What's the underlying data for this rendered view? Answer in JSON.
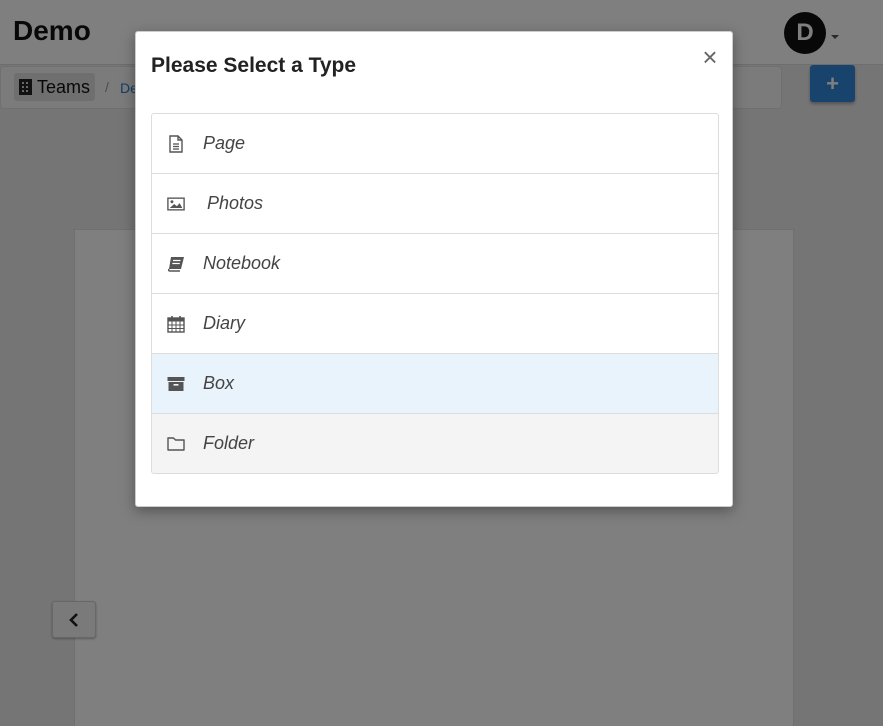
{
  "app": {
    "brand": "Demo",
    "avatar_initial": "D"
  },
  "breadcrumb": {
    "root_label": "Teams",
    "separator": "/",
    "next_label": "Demo"
  },
  "toolbar": {
    "add_symbol": "+"
  },
  "modal": {
    "title": "Please Select a Type",
    "close_symbol": "×",
    "options": [
      {
        "label": "Page",
        "icon": "file-text-icon"
      },
      {
        "label": "Photos",
        "icon": "image-icon"
      },
      {
        "label": "Notebook",
        "icon": "book-icon"
      },
      {
        "label": "Diary",
        "icon": "calendar-icon"
      },
      {
        "label": "Box",
        "icon": "archive-box-icon"
      },
      {
        "label": "Folder",
        "icon": "folder-icon"
      }
    ]
  },
  "colors": {
    "primary": "#2f86d8",
    "hover_row": "#e9f3fb",
    "link": "#2b7bc8"
  }
}
